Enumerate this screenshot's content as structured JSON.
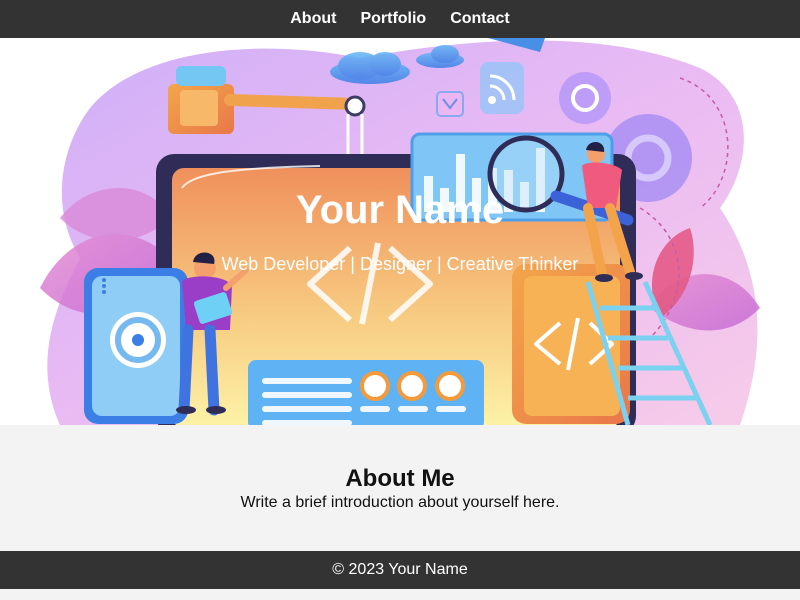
{
  "nav": {
    "items": [
      {
        "label": "About"
      },
      {
        "label": "Portfolio"
      },
      {
        "label": "Contact"
      }
    ]
  },
  "hero": {
    "title": "Your Name",
    "subtitle": "Web Developer | Designer | Creative Thinker",
    "illustration": "web-developer-workspace-illustration"
  },
  "about": {
    "heading": "About Me",
    "text": "Write a brief introduction about yourself here."
  },
  "footer": {
    "text": "© 2023 Your Name"
  },
  "colors": {
    "nav_bg": "#333333",
    "page_bg": "#f3f3f3",
    "footer_bg": "#333333",
    "hero_text": "#ffffff"
  }
}
